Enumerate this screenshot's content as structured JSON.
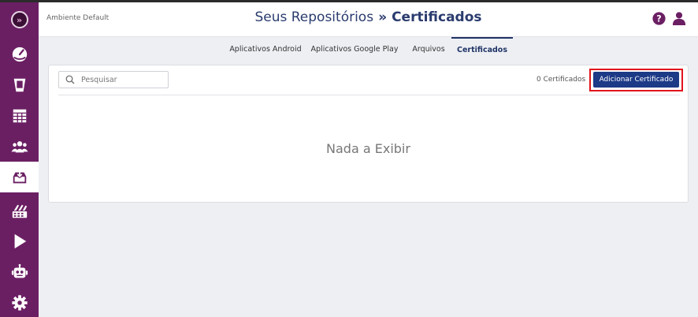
{
  "header": {
    "environment": "Ambiente Default",
    "title_prefix": "Seus Repositórios",
    "title_separator": "»",
    "title_current": "Certificados"
  },
  "tabs": [
    {
      "label": "Aplicativos Android",
      "active": false
    },
    {
      "label": "Aplicativos Google Play",
      "active": false
    },
    {
      "label": "Arquivos",
      "active": false
    },
    {
      "label": "Certificados",
      "active": true
    }
  ],
  "toolbar": {
    "search_placeholder": "Pesquisar",
    "count_text": "0 Certificados",
    "add_button_label": "Adicionar Certificado"
  },
  "content": {
    "empty_text": "Nada a Exibir"
  },
  "sidebar": {
    "items": [
      {
        "icon": "dashboard-icon",
        "active": false
      },
      {
        "icon": "device-icon",
        "active": false
      },
      {
        "icon": "table-icon",
        "active": false
      },
      {
        "icon": "users-icon",
        "active": false
      },
      {
        "icon": "repository-icon",
        "active": true
      },
      {
        "icon": "apps-icon",
        "active": false
      },
      {
        "icon": "play-store-icon",
        "active": false
      },
      {
        "icon": "android-robot-icon",
        "active": false
      },
      {
        "icon": "settings-icon",
        "active": false
      }
    ]
  },
  "colors": {
    "sidebar": "#6b1f63",
    "title": "#2a3b6e",
    "primary_button": "#1d3a87",
    "highlight": "#e1141b"
  }
}
